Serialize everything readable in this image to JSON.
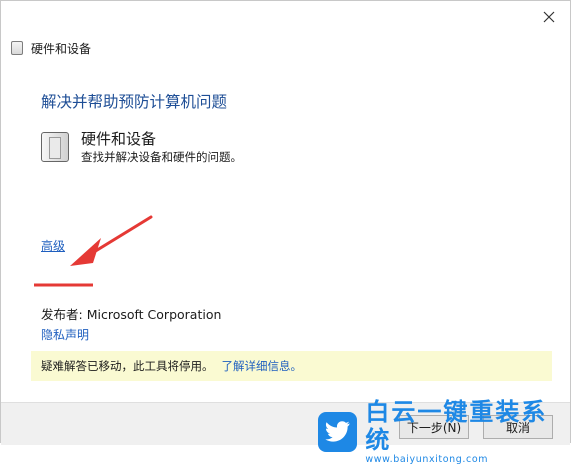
{
  "window": {
    "title": "硬件和设备",
    "close_icon": "close-icon"
  },
  "main": {
    "heading": "解决并帮助预防计算机问题",
    "item": {
      "title": "硬件和设备",
      "description": "查找并解决设备和硬件的问题。",
      "icon": "hardware-device-icon"
    },
    "advanced_link": "高级",
    "publisher_label": "发布者:",
    "publisher_value": "Microsoft Corporation",
    "privacy_link": "隐私声明"
  },
  "notice": {
    "text": "疑难解答已移动，此工具将停用。",
    "link": "了解详细信息",
    "period": "。",
    "background": "#fafad2"
  },
  "footer": {
    "next_button": "下一步(N)",
    "cancel_button": "取消"
  },
  "annotation": {
    "arrow_color": "#e53935"
  },
  "watermark": {
    "title": "白云一键重装系统",
    "url": "www.baiyunxitong.com",
    "icon": "twitter-bird-icon",
    "color": "#1e88e5"
  },
  "colors": {
    "heading": "#1e4e96",
    "link": "#1f5fbf"
  }
}
